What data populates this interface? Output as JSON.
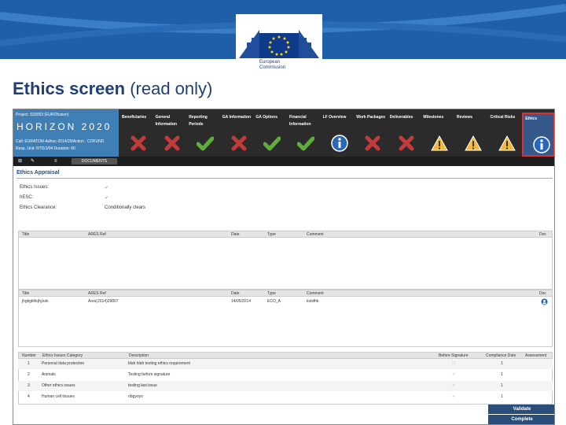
{
  "slide": {
    "logo": {
      "line1": "European",
      "line2": "Commission"
    },
    "title_bold": "Ethics screen",
    "title_rest": "(read only)"
  },
  "project": {
    "line1": "Project: 633053 (EUROfusion)",
    "logo_text": "HORIZON 2020",
    "line2": "Call: EURATOM-Adhoc-2014/20/Action : COFUND",
    "line3": "Resp. Unit: RTD/J/04        Duration: 60"
  },
  "tabs": [
    {
      "label": "Beneficiaries",
      "icon": "cross-icon"
    },
    {
      "label": "General Information",
      "icon": "cross-icon"
    },
    {
      "label": "Reporting Periods",
      "icon": "check-icon"
    },
    {
      "label": "GA Information",
      "icon": "cross-icon"
    },
    {
      "label": "GA Options",
      "icon": "check-icon"
    },
    {
      "label": "Financial Information",
      "icon": "check-icon"
    },
    {
      "label": "LF Overview",
      "icon": "info-icon"
    },
    {
      "label": "Work Packages",
      "icon": "cross-icon"
    },
    {
      "label": "Deliverables",
      "icon": "cross-icon"
    },
    {
      "label": "Milestones",
      "icon": "warning-icon"
    },
    {
      "label": "Reviews",
      "icon": "warning-icon"
    },
    {
      "label": "Critical Risks",
      "icon": "warning-icon"
    },
    {
      "label": "Ethics",
      "icon": "info-icon"
    }
  ],
  "toolbar": {
    "documents": "DOCUMENTS"
  },
  "appraisal": {
    "title": "Ethics Appraisal",
    "fields": [
      {
        "label": "Ethics Issues:",
        "value": "✔"
      },
      {
        "label": "hESC:",
        "value": "✔"
      },
      {
        "label": "Ethics Clearance:",
        "value": "Conditionally clears"
      }
    ]
  },
  "grid1": {
    "headers": [
      "Title",
      "ARES Ref",
      "Date",
      "Type",
      "Comment",
      "Doc"
    ]
  },
  "grid2": {
    "headers": [
      "Title",
      "ARES Ref",
      "Date",
      "Type",
      "Comment",
      "Doc"
    ],
    "rows": [
      {
        "title": "jhgkgkhkjhj,ksk",
        "ares": "Ares(2014)29807",
        "date": "14/05/2014",
        "type": "ECO_A",
        "comment": "kstsfhk"
      }
    ]
  },
  "grid3": {
    "headers": [
      "Number",
      "Ethics Issues Category",
      "Description",
      "Before Signature",
      "Compliance Date",
      "Assessment"
    ],
    "rows": [
      {
        "num": "1",
        "cat": "Personal data protection",
        "desc": "blah blah testing ethics requirement",
        "comp": "1"
      },
      {
        "num": "2",
        "cat": "Animals",
        "desc": "Testing before signature",
        "comp": "1"
      },
      {
        "num": "3",
        "cat": "Other ethics issues",
        "desc": "testing last issue",
        "comp": "1"
      },
      {
        "num": "4",
        "cat": "Human cell tissues",
        "desc": "nbgyoyo",
        "comp": "1"
      }
    ]
  },
  "buttons": {
    "validate": "Validate",
    "complete": "Complete"
  }
}
